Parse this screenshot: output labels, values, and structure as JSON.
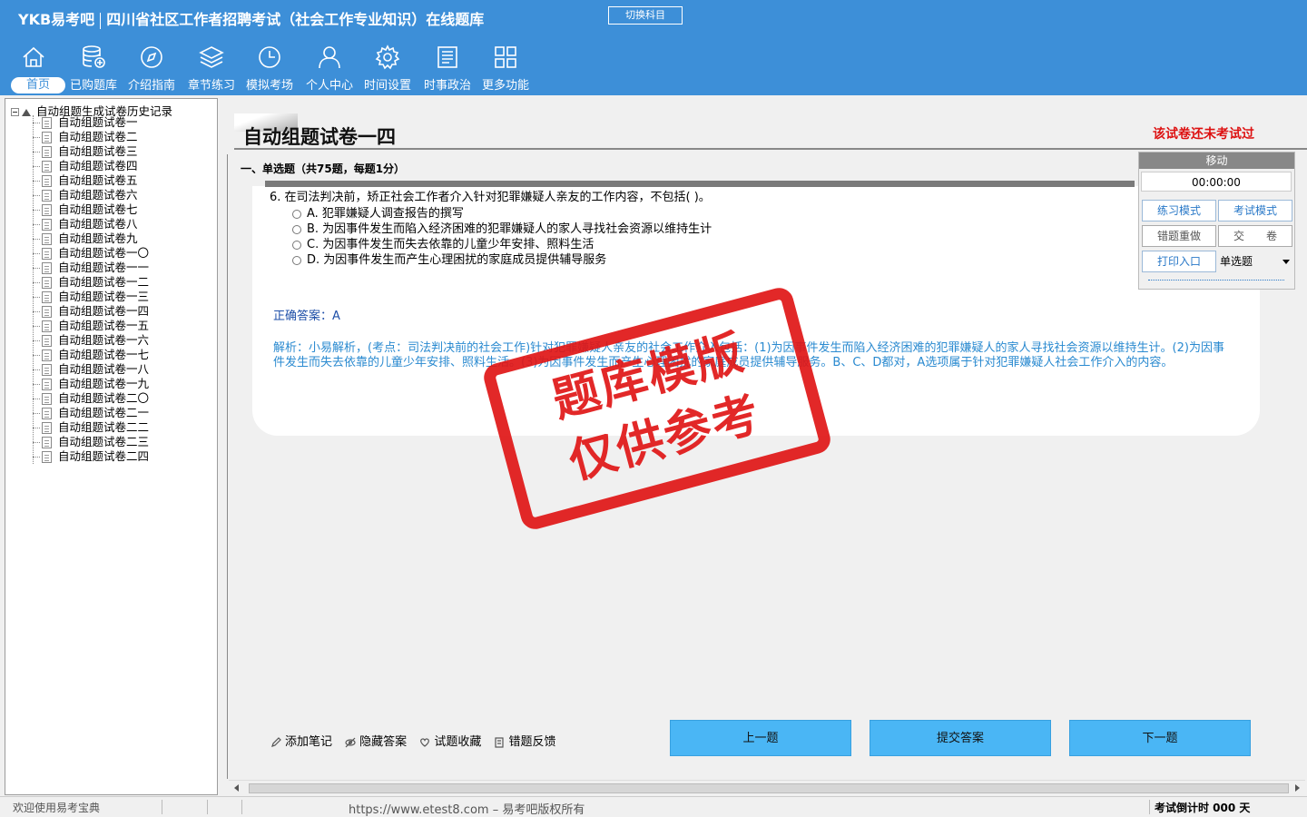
{
  "header": {
    "brand": "YKB易考吧",
    "title": "四川省社区工作者招聘考试（社会工作专业知识）在线题库",
    "switch_label": "切换科目"
  },
  "nav": [
    {
      "label": "首页",
      "icon": "home-icon"
    },
    {
      "label": "已购题库",
      "icon": "database-icon"
    },
    {
      "label": "介绍指南",
      "icon": "compass-icon"
    },
    {
      "label": "章节练习",
      "icon": "layers-icon"
    },
    {
      "label": "模拟考场",
      "icon": "clock-icon"
    },
    {
      "label": "个人中心",
      "icon": "user-icon"
    },
    {
      "label": "时间设置",
      "icon": "gear-icon"
    },
    {
      "label": "时事政治",
      "icon": "news-icon"
    },
    {
      "label": "更多功能",
      "icon": "grid-icon"
    }
  ],
  "tree": {
    "root": "自动组题生成试卷历史记录",
    "items": [
      "自动组题试卷一",
      "自动组题试卷二",
      "自动组题试卷三",
      "自动组题试卷四",
      "自动组题试卷五",
      "自动组题试卷六",
      "自动组题试卷七",
      "自动组题试卷八",
      "自动组题试卷九",
      "自动组题试卷一〇",
      "自动组题试卷一一",
      "自动组题试卷一二",
      "自动组题试卷一三",
      "自动组题试卷一四",
      "自动组题试卷一五",
      "自动组题试卷一六",
      "自动组题试卷一七",
      "自动组题试卷一八",
      "自动组题试卷一九",
      "自动组题试卷二〇",
      "自动组题试卷二一",
      "自动组题试卷二二",
      "自动组题试卷二三",
      "自动组题试卷二四"
    ]
  },
  "paper": {
    "title": "自动组题试卷一四",
    "status": "该试卷还未考试过",
    "section": "一、单选题（共75题，每题1分）",
    "question": "6. 在司法判决前，矫正社会工作者介入针对犯罪嫌疑人亲友的工作内容，不包括( )。",
    "options": [
      "A. 犯罪嫌疑人调查报告的撰写",
      "B. 为因事件发生而陷入经济困难的犯罪嫌疑人的家人寻找社会资源以维持生计",
      "C. 为因事件发生而失去依靠的儿童少年安排、照料生活",
      "D. 为因事件发生而产生心理困扰的家庭成员提供辅导服务"
    ],
    "answer": "正确答案：A",
    "explanation": "解析：小易解析，(考点：司法判决前的社会工作)针对犯罪嫌疑人亲友的社会工作介入包括：(1)为因事件发生而陷入经济困难的犯罪嫌疑人的家人寻找社会资源以维持生计。(2)为因事件发生而失去依靠的儿童少年安排、照料生活。(3)为因事件发生而产生心理困扰的家庭成员提供辅导服务。B、C、D都对，A选项属于针对犯罪嫌疑人社会工作介入的内容。"
  },
  "stamp": {
    "line1": "题库模版",
    "line2": "仅供参考"
  },
  "control": {
    "move": "移动",
    "timer": "00:00:00",
    "practice_mode": "练习模式",
    "exam_mode": "考试模式",
    "redo_wrong": "错题重做",
    "submit_paper": "交　　卷",
    "print": "打印入口",
    "type_select": "单选题"
  },
  "tools": {
    "note": "添加笔记",
    "hide_answer": "隐藏答案",
    "favorite": "试题收藏",
    "feedback": "错题反馈"
  },
  "buttons": {
    "prev": "上一题",
    "submit": "提交答案",
    "next": "下一题"
  },
  "statusbar": {
    "welcome": "欢迎使用易考宝典",
    "url": "https://www.etest8.com – 易考吧版权所有",
    "countdown": "考试倒计时 000 天"
  }
}
